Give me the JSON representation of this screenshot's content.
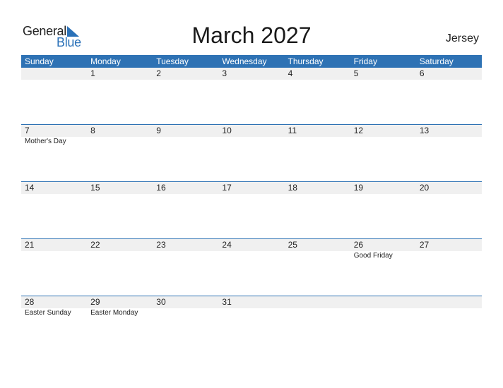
{
  "logo": {
    "line1": "General",
    "line2": "Blue"
  },
  "title": "March 2027",
  "region": "Jersey",
  "colors": {
    "header_bg": "#2e72b4",
    "date_strip": "#f0f0f0",
    "logo_blue": "#2a71b8"
  },
  "weekdays": [
    "Sunday",
    "Monday",
    "Tuesday",
    "Wednesday",
    "Thursday",
    "Friday",
    "Saturday"
  ],
  "weeks": [
    [
      {
        "d": ""
      },
      {
        "d": "1"
      },
      {
        "d": "2"
      },
      {
        "d": "3"
      },
      {
        "d": "4"
      },
      {
        "d": "5"
      },
      {
        "d": "6"
      }
    ],
    [
      {
        "d": "7",
        "e": "Mother's Day"
      },
      {
        "d": "8"
      },
      {
        "d": "9"
      },
      {
        "d": "10"
      },
      {
        "d": "11"
      },
      {
        "d": "12"
      },
      {
        "d": "13"
      }
    ],
    [
      {
        "d": "14"
      },
      {
        "d": "15"
      },
      {
        "d": "16"
      },
      {
        "d": "17"
      },
      {
        "d": "18"
      },
      {
        "d": "19"
      },
      {
        "d": "20"
      }
    ],
    [
      {
        "d": "21"
      },
      {
        "d": "22"
      },
      {
        "d": "23"
      },
      {
        "d": "24"
      },
      {
        "d": "25"
      },
      {
        "d": "26",
        "e": "Good Friday"
      },
      {
        "d": "27"
      }
    ],
    [
      {
        "d": "28",
        "e": "Easter Sunday"
      },
      {
        "d": "29",
        "e": "Easter Monday"
      },
      {
        "d": "30"
      },
      {
        "d": "31"
      },
      {
        "d": ""
      },
      {
        "d": ""
      },
      {
        "d": ""
      }
    ]
  ]
}
